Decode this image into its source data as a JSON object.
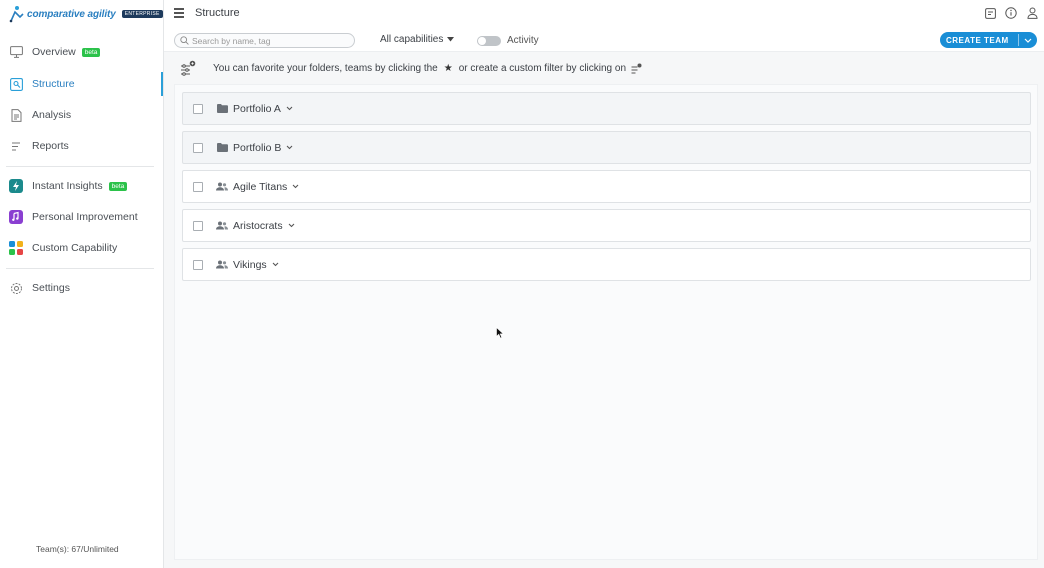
{
  "sidebar": {
    "logo": {
      "text": "comparative agility",
      "badge": "ENTERPRISE"
    },
    "items": [
      {
        "label": "Overview",
        "icon": "monitor-icon",
        "beta": "beta"
      },
      {
        "label": "Structure",
        "icon": "structure-icon",
        "active": true
      },
      {
        "label": "Analysis",
        "icon": "document-icon"
      },
      {
        "label": "Reports",
        "icon": "list-icon"
      },
      {
        "label": "Instant Insights",
        "icon": "lightning-icon",
        "beta": "beta"
      },
      {
        "label": "Personal Improvement",
        "icon": "music-icon"
      },
      {
        "label": "Custom Capability",
        "icon": "grid-dots-icon"
      },
      {
        "label": "Settings",
        "icon": "gear-icon"
      }
    ],
    "teams_count": "Team(s): 67/Unlimited"
  },
  "topbar": {
    "title": "Structure"
  },
  "toolbar": {
    "search_placeholder": "Search by name, tag",
    "capabilities_label": "All capabilities",
    "activity_label": "Activity",
    "create_team_label": "CREATE TEAM"
  },
  "banner": {
    "text_before": "You can favorite your folders, teams by clicking the",
    "text_after": "or create a custom filter by clicking on"
  },
  "rows": [
    {
      "name": "Portfolio A",
      "type": "folder"
    },
    {
      "name": "Portfolio B",
      "type": "folder"
    },
    {
      "name": "Agile Titans",
      "type": "team"
    },
    {
      "name": "Aristocrats",
      "type": "team"
    },
    {
      "name": "Vikings",
      "type": "team"
    }
  ],
  "colors": {
    "accent": "#1a8ed6",
    "beta": "#2bc24a",
    "active_text": "#2a7fc0"
  }
}
